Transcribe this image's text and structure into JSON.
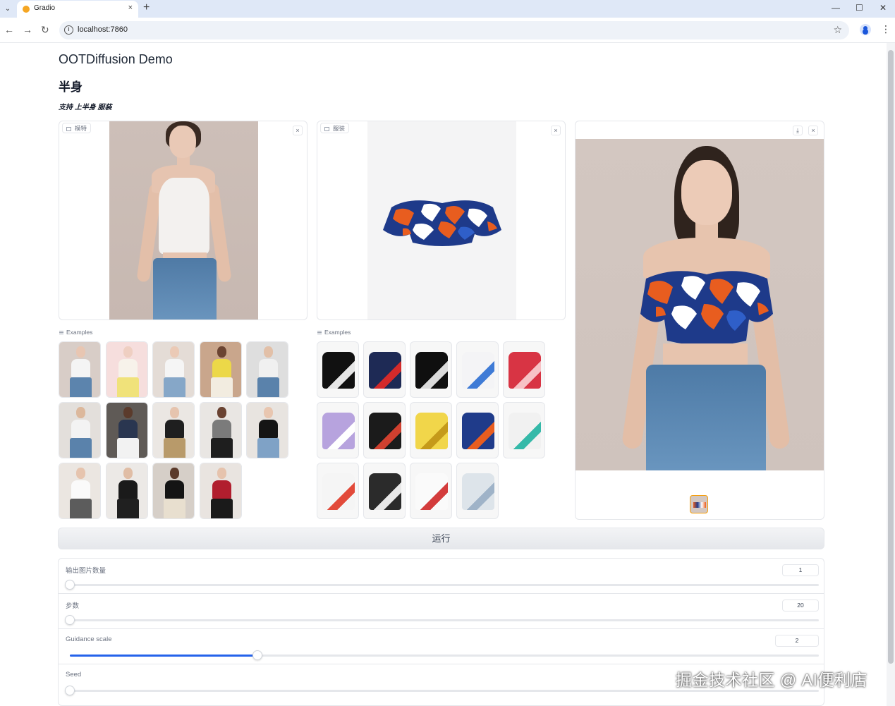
{
  "browser": {
    "tab_title": "Gradio",
    "url": "localhost:7860",
    "tab_close": "×",
    "new_tab": "+",
    "minimize": "—",
    "maximize": "☐",
    "close": "✕"
  },
  "app": {
    "title": "OOTDiffusion Demo",
    "section_title": "半身",
    "section_subtitle": "支持 上半身 服装"
  },
  "inputs": {
    "model_label": "模特",
    "garment_label": "服装",
    "clear_symbol": "×"
  },
  "examples_label": "Examples",
  "model_examples": [
    {
      "top": "#f4f4f4",
      "bottom": "#5c84ad",
      "bg": "#d8cdc7",
      "skin": "#e8c6b2"
    },
    {
      "top": "#f7f2ea",
      "bottom": "#f0e27a",
      "bg": "#f6dedd",
      "skin": "#efcfc2"
    },
    {
      "top": "#f5f5f5",
      "bottom": "#86a7c8",
      "bg": "#e4dcd6",
      "skin": "#ebcab6"
    },
    {
      "top": "#ecd848",
      "bottom": "#f2ece0",
      "bg": "#c9a68c",
      "skin": "#6b4432"
    },
    {
      "top": "#f0f0f0",
      "bottom": "#5a82ab",
      "bg": "#dedede",
      "skin": "#e2c0a8"
    },
    {
      "top": "#f3f3f3",
      "bottom": "#5a82ab",
      "bg": "#e3dfdb",
      "skin": "#dcb89c"
    },
    {
      "top": "#2a3650",
      "bottom": "#f2f2f2",
      "bg": "#5f5a56",
      "skin": "#5b3b2c"
    },
    {
      "top": "#1f1f1f",
      "bottom": "#b89a6a",
      "bg": "#ebe7e3",
      "skin": "#e6c4ae"
    },
    {
      "top": "#7b7b7b",
      "bottom": "#1e1e1e",
      "bg": "#e9e6e3",
      "skin": "#6a4332"
    },
    {
      "top": "#151515",
      "bottom": "#7fa2c6",
      "bg": "#e8e4e0",
      "skin": "#e8c6b0"
    },
    {
      "top": "#fafafa",
      "bottom": "#5c5c5c",
      "bg": "#ebe6e1",
      "skin": "#e6c4ae"
    },
    {
      "top": "#1a1a1a",
      "bottom": "#202020",
      "bg": "#ece9e6",
      "skin": "#e0bda5"
    },
    {
      "top": "#141414",
      "bottom": "#e8dfcf",
      "bg": "#d6cfc8",
      "skin": "#5b3a2a"
    },
    {
      "top": "#b11e2e",
      "bottom": "#1a1a1a",
      "bg": "#e9e4e0",
      "skin": "#e6c3ad"
    }
  ],
  "garment_examples": [
    {
      "color": "#111111",
      "accent": "#e6e6e6"
    },
    {
      "color": "#1e2a55",
      "accent": "#d42a2a"
    },
    {
      "color": "#0f0f0f",
      "accent": "#dadada"
    },
    {
      "color": "#f4f4f6",
      "accent": "#3f7bd6"
    },
    {
      "color": "#d83444",
      "accent": "#f7c2c6"
    },
    {
      "color": "#b7a3de",
      "accent": "#ffffff"
    },
    {
      "color": "#1b1b1b",
      "accent": "#d0402f"
    },
    {
      "color": "#f1d64a",
      "accent": "#c59a1a"
    },
    {
      "color": "#1f3b8a",
      "accent": "#e85d1f"
    },
    {
      "color": "#f1f1f1",
      "accent": "#35b9a9"
    },
    {
      "color": "#f5f5f5",
      "accent": "#e24a3a"
    },
    {
      "color": "#2b2b2b",
      "accent": "#e8e8e8"
    },
    {
      "color": "#fafafa",
      "accent": "#d33c3c"
    },
    {
      "color": "#dde4ea",
      "accent": "#9fb3c8"
    }
  ],
  "run_button": "运行",
  "sliders": [
    {
      "label": "输出图片数量",
      "value": "1",
      "fill": 0.0
    },
    {
      "label": "步数",
      "value": "20",
      "fill": 0.0
    },
    {
      "label": "Guidance scale",
      "value": "2",
      "fill": 0.25
    },
    {
      "label": "Seed",
      "value": "",
      "fill": 0.0
    }
  ],
  "watermark": "掘金技术社区 @ AI便利店",
  "colors": {
    "accent": "#2563eb",
    "border": "#e5e7eb",
    "garment_orange": "#e85d1f",
    "garment_navy": "#1e3a8a",
    "garment_blue": "#2f5fc9"
  }
}
